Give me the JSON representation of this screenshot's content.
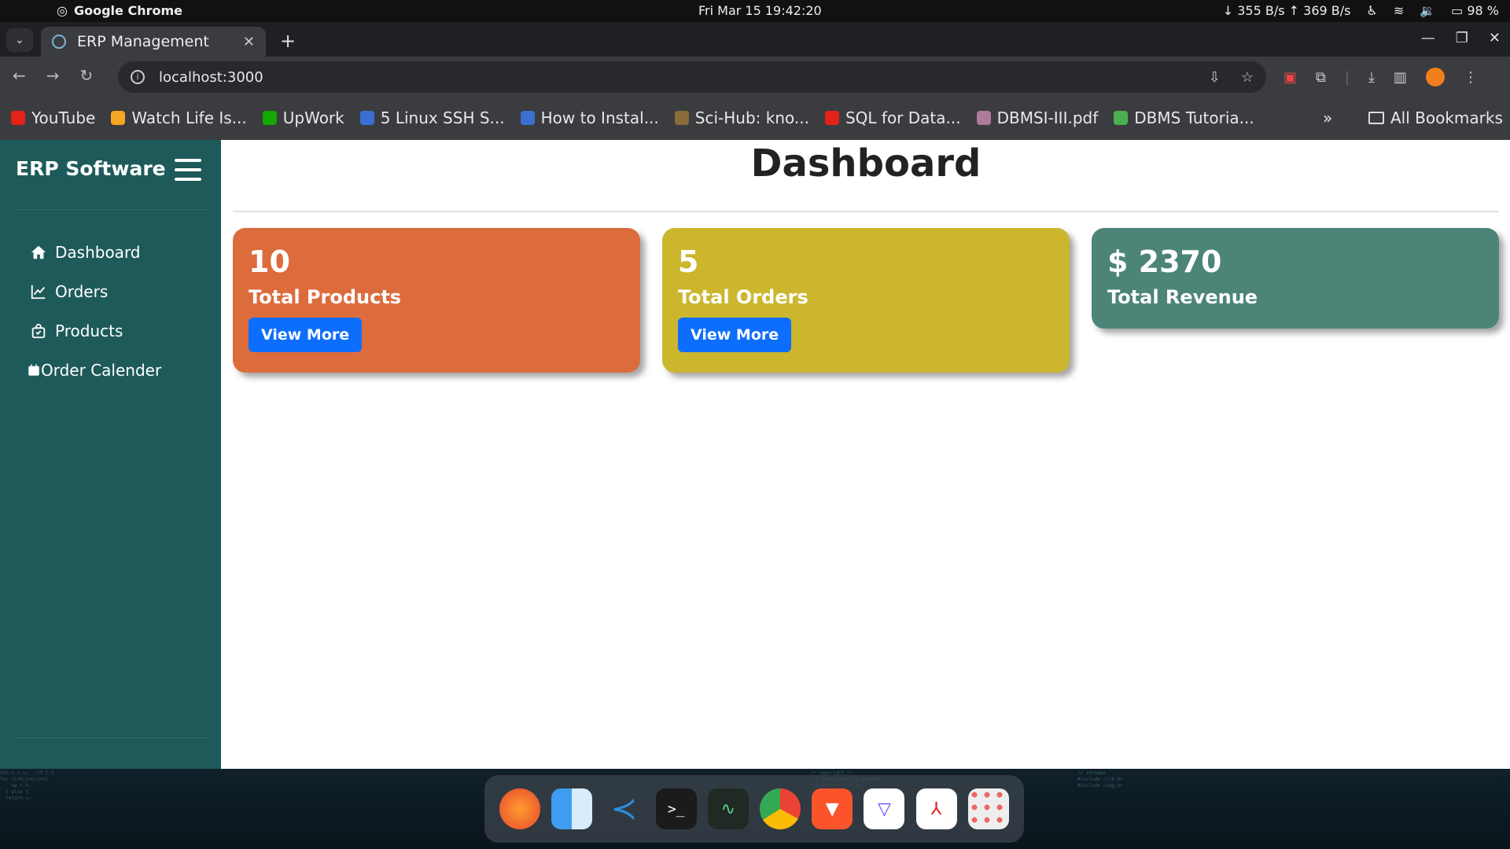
{
  "os_bar": {
    "app_name": "Google Chrome",
    "clock": "Fri Mar 15  19:42:20",
    "network": "↓ 355 B/s ↑ 369 B/s",
    "battery": "98 %"
  },
  "browser": {
    "tab_title": "ERP Management",
    "url": "localhost:3000",
    "bookmarks": [
      {
        "label": "YouTube",
        "color": "#e62117"
      },
      {
        "label": "Watch Life Is...",
        "color": "#f5a623"
      },
      {
        "label": "UpWork",
        "color": "#14a800"
      },
      {
        "label": "5 Linux SSH S...",
        "color": "#3b6fd1"
      },
      {
        "label": "How to Instal...",
        "color": "#3b6fd1"
      },
      {
        "label": "Sci-Hub: kno...",
        "color": "#8a6d3b"
      },
      {
        "label": "SQL for Data...",
        "color": "#e62117"
      },
      {
        "label": "DBMSI-III.pdf",
        "color": "#b07a9a"
      },
      {
        "label": "DBMS Tutoria...",
        "color": "#4caf50"
      }
    ],
    "all_bookmarks": "All Bookmarks"
  },
  "sidebar": {
    "brand": "ERP Software",
    "items": [
      {
        "label": "Dashboard",
        "icon": "home-icon"
      },
      {
        "label": "Orders",
        "icon": "chart-line-icon"
      },
      {
        "label": "Products",
        "icon": "bag-icon"
      },
      {
        "label": "Order Calender",
        "icon": "calendar-icon"
      }
    ]
  },
  "main": {
    "title": "Dashboard",
    "cards": [
      {
        "value": "10",
        "label": "Total Products",
        "button": "View More",
        "color": "#dd6c3d"
      },
      {
        "value": "5",
        "label": "Total Orders",
        "button": "View More",
        "color": "#cbb62d"
      },
      {
        "value": "$ 2370",
        "label": "Total Revenue",
        "color": "#4c8577"
      }
    ]
  },
  "dock": {
    "apps": [
      "firefox-icon",
      "finder-icon",
      "vscode-icon",
      "terminal-icon",
      "system-monitor-icon",
      "chrome-icon",
      "brave-icon",
      "proton-vpn-icon",
      "acrobat-icon",
      "app-grid-icon"
    ]
  }
}
